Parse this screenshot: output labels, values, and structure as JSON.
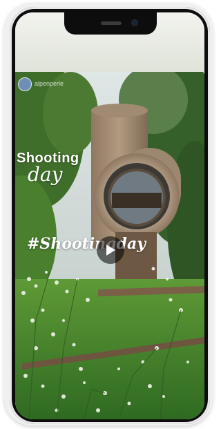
{
  "story": {
    "username": "alpenperle",
    "caption_shooting": "Shooting",
    "caption_day": "day",
    "caption_hashtag": "#Shootingday"
  },
  "icons": {
    "play": "play-icon",
    "avatar": "avatar-icon"
  },
  "colors": {
    "phone_frame": "#0d0d0d",
    "grass": "#4e8a2f",
    "tower": "#a48c75"
  }
}
